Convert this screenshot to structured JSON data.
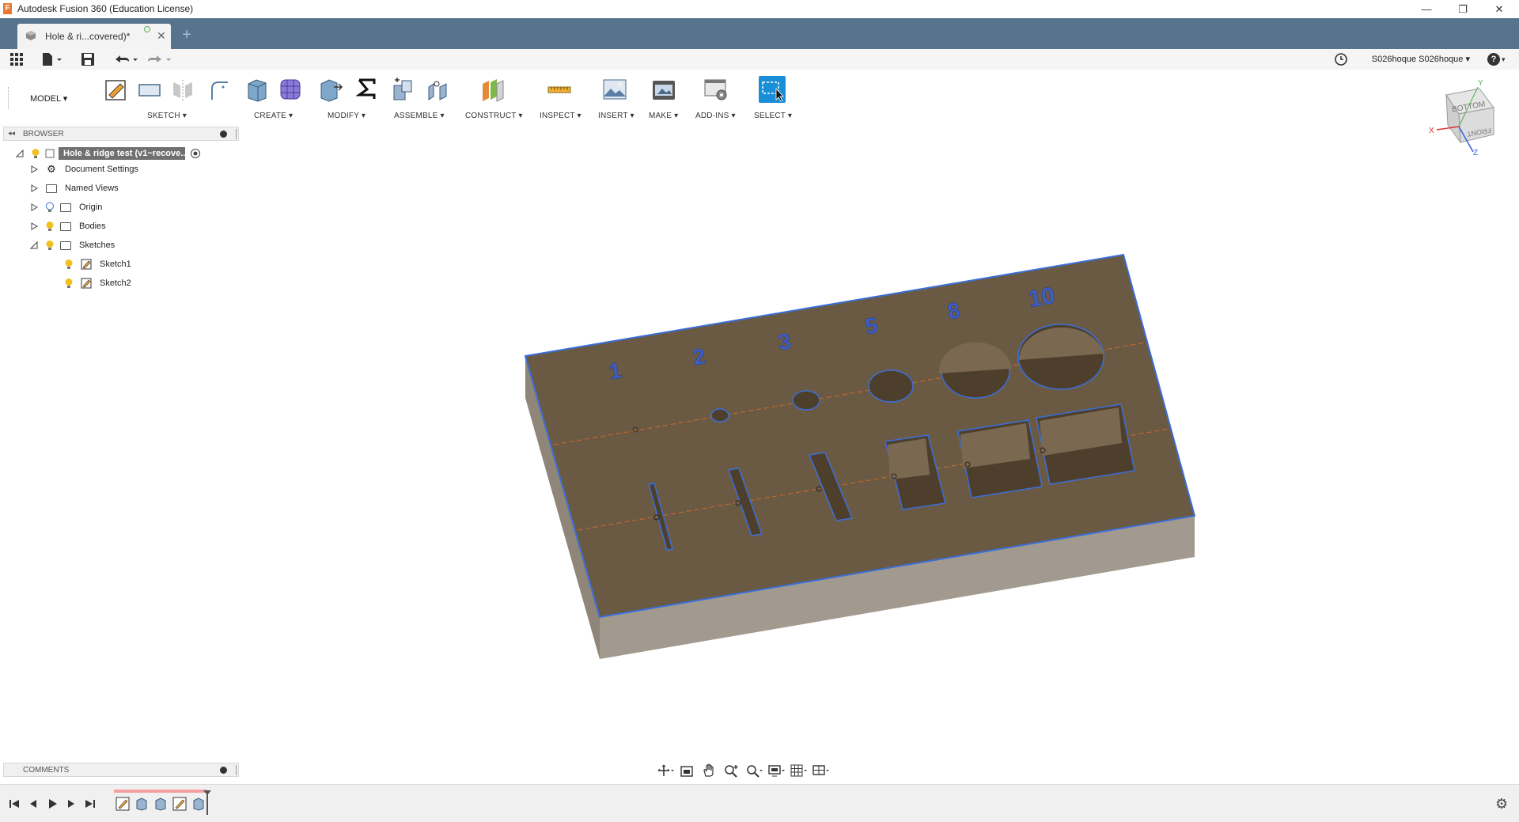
{
  "window": {
    "title": "Autodesk Fusion 360 (Education License)",
    "app_icon_letter": "F",
    "minimize": "—",
    "restore": "❐",
    "close": "✕"
  },
  "tabs": [
    {
      "label": "Hole & ri...covered)*",
      "close": "✕"
    }
  ],
  "new_tab": "+",
  "quick_access": {
    "user": "S026hoque S026hoque ▾",
    "help": "?"
  },
  "toolbar": {
    "workspace": "MODEL ▾",
    "groups": [
      {
        "label": "SKETCH ▾"
      },
      {
        "label": "CREATE ▾"
      },
      {
        "label": "MODIFY ▾"
      },
      {
        "label": "ASSEMBLE ▾"
      },
      {
        "label": "CONSTRUCT ▾"
      },
      {
        "label": "INSPECT ▾"
      },
      {
        "label": "INSERT ▾"
      },
      {
        "label": "MAKE ▾"
      },
      {
        "label": "ADD-INS ▾"
      },
      {
        "label": "SELECT ▾"
      }
    ]
  },
  "browser": {
    "title": "BROWSER",
    "root": "Hole & ridge test (v1~recove...",
    "items": [
      {
        "label": "Document Settings"
      },
      {
        "label": "Named Views"
      },
      {
        "label": "Origin"
      },
      {
        "label": "Bodies"
      },
      {
        "label": "Sketches"
      },
      {
        "label": "Sketch1"
      },
      {
        "label": "Sketch2"
      }
    ]
  },
  "comments": {
    "title": "COMMENTS"
  },
  "viewcube": {
    "top": "BOTTOM",
    "front": "FRONT",
    "axis_x": "X",
    "axis_y": "Y",
    "axis_z": "Z"
  },
  "model": {
    "hole_labels": [
      "1",
      "2",
      "3",
      "5",
      "8",
      "10"
    ],
    "body_color": "#6b5a43",
    "edge_color": "#3a6fd8"
  },
  "colors": {
    "tabbar": "#57748f",
    "select_accent": "#1a8fd8"
  }
}
